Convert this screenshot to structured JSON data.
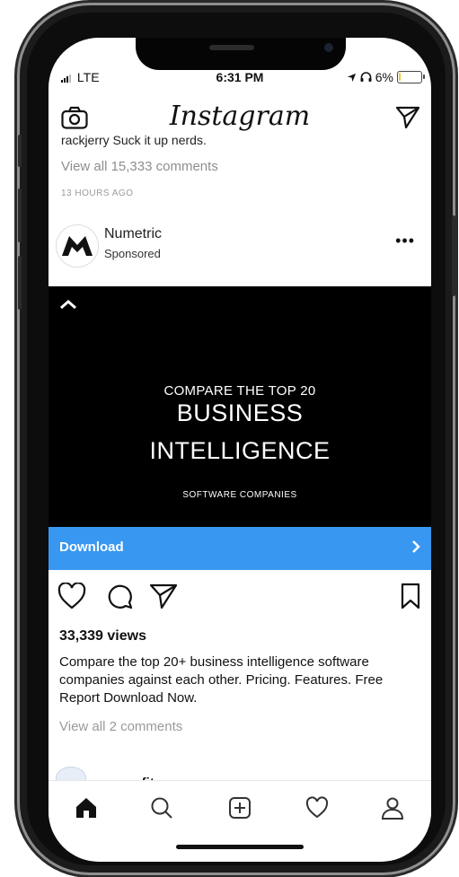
{
  "status": {
    "signal": "LTE",
    "time": "6:31 PM",
    "battery": "6%",
    "battery_level": 0.06
  },
  "header": {
    "logo": "Instagram"
  },
  "previous_post": {
    "clipped_comment": "rackjerry Suck it up nerds.",
    "view_all_comments": "View all 15,333 comments",
    "time_ago": "13 HOURS AGO"
  },
  "post": {
    "account_name": "Numetric",
    "label": "Sponsored",
    "ad": {
      "line1": "COMPARE THE TOP 20",
      "line2": "BUSINESS",
      "line3": "INTELLIGENCE",
      "line4": "SOFTWARE COMPANIES"
    },
    "cta": "Download",
    "views": "33,339 views",
    "caption": "Compare the top 20+ business intelligence software companies against each other. Pricing. Features. Free Report Download Now.",
    "view_all_comments": "View all 2 comments"
  },
  "next_post": {
    "account_name": "oreoofitnomes"
  },
  "icons": {
    "camera": "camera-icon",
    "direct": "send-icon",
    "more": "more-icon",
    "like": "heart-icon",
    "comment": "comment-icon",
    "share": "share-icon",
    "save": "bookmark-icon",
    "home": "home-icon",
    "search": "search-icon",
    "add": "add-icon",
    "activity": "heart-icon",
    "profile": "profile-icon"
  },
  "colors": {
    "accent": "#3897f0",
    "ad_background": "#000000",
    "battery": "#f2c832"
  }
}
